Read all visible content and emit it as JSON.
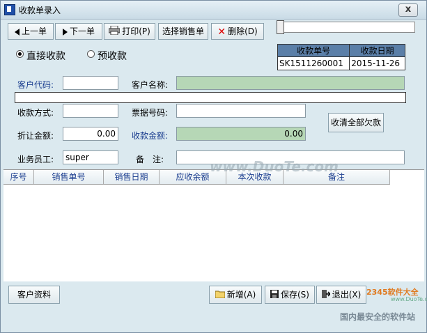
{
  "window": {
    "title": "收款单录入",
    "close_glyph": "x"
  },
  "toolbar": {
    "prev_label": "上一单",
    "next_label": "下一单",
    "print_label": "打印(P)",
    "select_sales_label": "选择销售单",
    "delete_label": "删除(D)"
  },
  "payment_mode": {
    "direct_label": "直接收款",
    "prepay_label": "预收款",
    "selected": "直接收款"
  },
  "doc_info": {
    "col1_header": "收款单号",
    "col2_header": "收款日期",
    "doc_no": "SK1511260001",
    "doc_date": "2015-11-26"
  },
  "form": {
    "customer_code_label": "客户代码:",
    "customer_code_value": "",
    "customer_name_label": "客户名称:",
    "customer_name_value": "",
    "pay_method_label": "收款方式:",
    "pay_method_value": "",
    "bill_no_label": "票据号码:",
    "bill_no_value": "",
    "discount_label": "折让金额:",
    "discount_value": "0.00",
    "received_label": "收款金额:",
    "received_value": "0.00",
    "clear_debt_label": "收清全部欠款",
    "salesman_label": "业务员工:",
    "salesman_value": "super",
    "remark_label": "备　注:",
    "remark_value": ""
  },
  "grid": {
    "columns": [
      "序号",
      "销售单号",
      "销售日期",
      "应收余额",
      "本次收款",
      "备注"
    ],
    "rows": []
  },
  "footer": {
    "customer_info_label": "客户资料",
    "new_label": "新增(A)",
    "save_label": "保存(S)",
    "exit_label": "退出(X)"
  },
  "watermarks": {
    "center": "www.DuoTe.com",
    "brand": "2345软件大全",
    "site": "www.DuoTe.com",
    "slogan": "国内最安全的软件站"
  }
}
